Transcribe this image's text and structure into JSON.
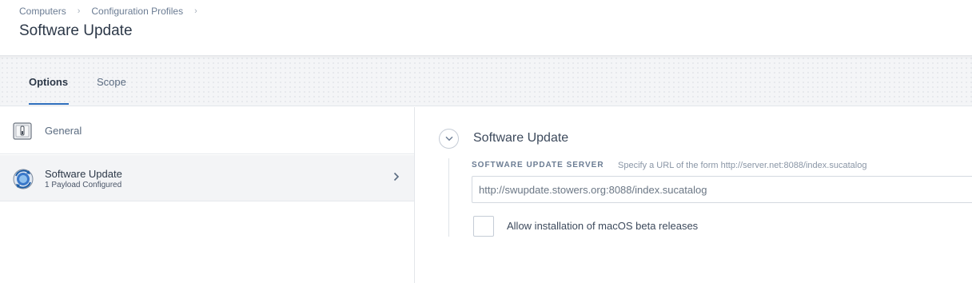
{
  "breadcrumb": {
    "items": [
      "Computers",
      "Configuration Profiles"
    ],
    "separator": "›"
  },
  "page": {
    "title": "Software Update"
  },
  "tabs": [
    {
      "label": "Options",
      "active": true
    },
    {
      "label": "Scope",
      "active": false
    }
  ],
  "payloads": [
    {
      "label": "General",
      "icon": "general-settings-icon"
    },
    {
      "label": "Software Update",
      "subtitle": "1 Payload Configured",
      "icon": "software-update-icon",
      "selected": true
    }
  ],
  "section": {
    "title": "Software Update",
    "server_field": {
      "label": "SOFTWARE UPDATE SERVER",
      "hint": "Specify a URL of the form http://server.net:8088/index.sucatalog",
      "value": "http://swupdate.stowers.org:8088/index.sucatalog"
    },
    "beta_checkbox": {
      "label": "Allow installation of macOS beta releases",
      "checked": false
    }
  },
  "colors": {
    "accent": "#2f6fbd",
    "text_primary": "#2c3848",
    "text_secondary": "#6b7c93",
    "selected_row_bg": "#f3f4f6"
  }
}
